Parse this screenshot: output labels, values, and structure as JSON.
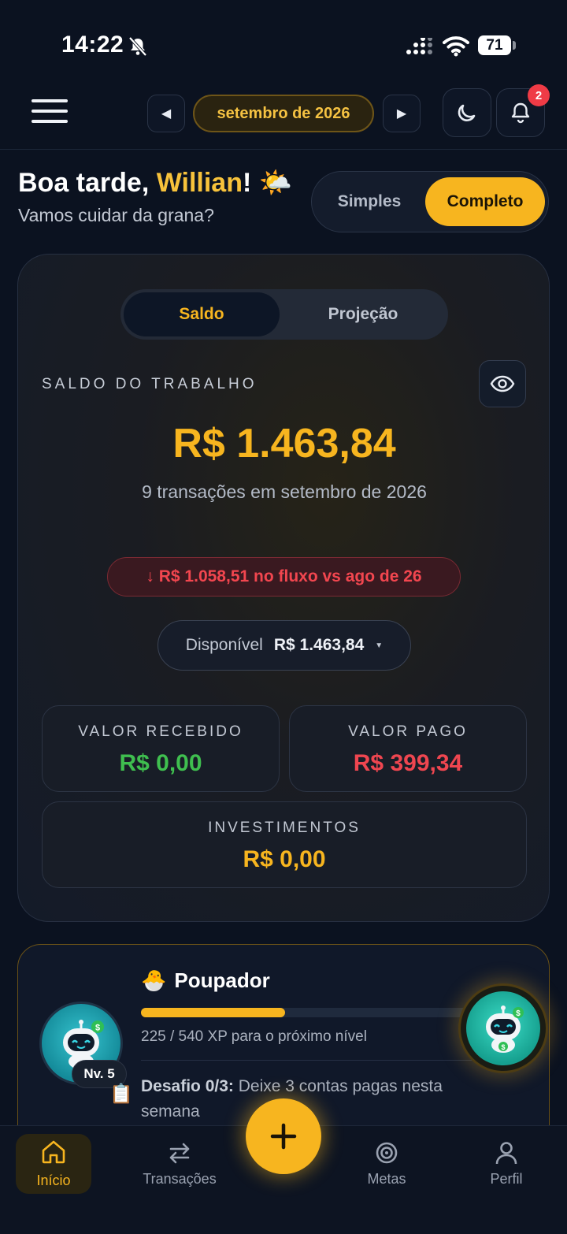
{
  "status_bar": {
    "time": "14:22",
    "battery": "71"
  },
  "header": {
    "month_label": "setembro de 2026",
    "notifications_count": "2",
    "icons": {
      "menu": "hamburger-menu-icon",
      "prev": "chevron-left-icon",
      "next": "chevron-right-icon",
      "theme": "moon-icon",
      "notifications": "bell-icon"
    }
  },
  "greeting": {
    "hello": "Boa tarde, ",
    "name": "Willian",
    "exclaim": "!",
    "emoji": "🌤️",
    "subtitle": "Vamos cuidar da grana?"
  },
  "mode_toggle": {
    "simple": "Simples",
    "complete": "Completo",
    "selected": "Completo"
  },
  "balance_card": {
    "tabs": {
      "saldo": "Saldo",
      "projecao": "Projeção",
      "selected": "Saldo"
    },
    "label": "SALDO DO TRABALHO",
    "balance": "R$ 1.463,84",
    "transactions_text": "9 transações em setembro de 2026",
    "flow_text": "↓ R$ 1.058,51 no fluxo vs ago de 26",
    "available_label": "Disponível",
    "available_value": "R$ 1.463,84",
    "available_caret": "▼",
    "received": {
      "title": "VALOR RECEBIDO",
      "value": "R$ 0,00",
      "color": "#3fbf4f"
    },
    "paid": {
      "title": "VALOR PAGO",
      "value": "R$ 399,34",
      "color": "#ef4650"
    },
    "investments": {
      "title": "INVESTIMENTOS",
      "value": "R$ 0,00",
      "color": "#f7b51f"
    }
  },
  "level_card": {
    "emoji": "🐣",
    "title": "Poupador",
    "xp_current": 225,
    "xp_total": 540,
    "xp_text": "225 / 540 XP para o próximo nível",
    "level_badge": "Nv. 5",
    "challenge_icon": "📋",
    "challenge_title": "Desafio 0/3:",
    "challenge_text": " Deixe 3 contas pagas nesta semana"
  },
  "nav": {
    "items": [
      {
        "label": "Início",
        "icon": "home-icon",
        "active": true
      },
      {
        "label": "Transações",
        "icon": "swap-arrows-icon",
        "active": false
      },
      {
        "label": "Metas",
        "icon": "target-icon",
        "active": false
      },
      {
        "label": "Perfil",
        "icon": "user-icon",
        "active": false
      }
    ],
    "fab_icon": "plus-icon"
  },
  "colors": {
    "accent": "#f7b51f",
    "background": "#0b1220",
    "negative": "#ef4650",
    "positive": "#3fbf4f"
  }
}
